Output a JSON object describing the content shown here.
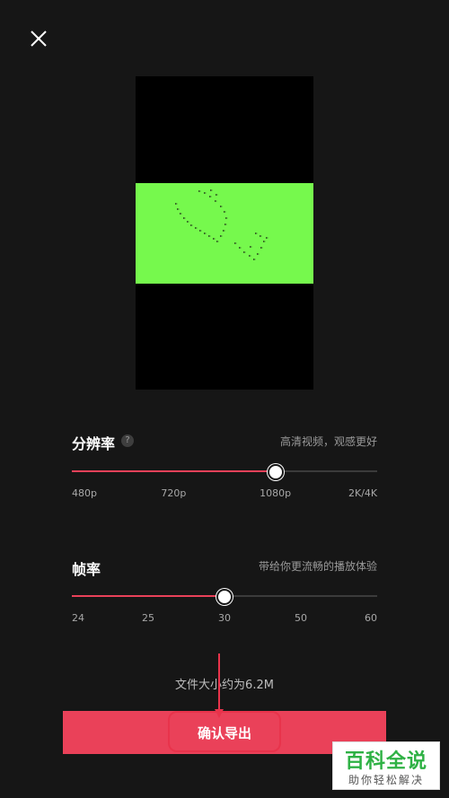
{
  "resolution": {
    "title": "分辨率",
    "help": "?",
    "description": "高清视频，观感更好",
    "ticks": [
      "480p",
      "720p",
      "1080p",
      "2K/4K"
    ],
    "selected": "1080p",
    "value_fraction": 0.667
  },
  "framerate": {
    "title": "帧率",
    "description": "带给你更流畅的播放体验",
    "ticks": [
      "24",
      "25",
      "30",
      "50",
      "60"
    ],
    "selected": "30",
    "value_fraction": 0.5
  },
  "file_size": "文件大小约为6.2M",
  "confirm_button": "确认导出",
  "watermark": {
    "title": "百科全说",
    "subtitle": "助你轻松解决"
  },
  "colors": {
    "accent": "#ea4159",
    "background": "#161616",
    "preview_green": "#76f94d"
  },
  "icons": {
    "close": "close-icon",
    "help": "question-icon"
  }
}
